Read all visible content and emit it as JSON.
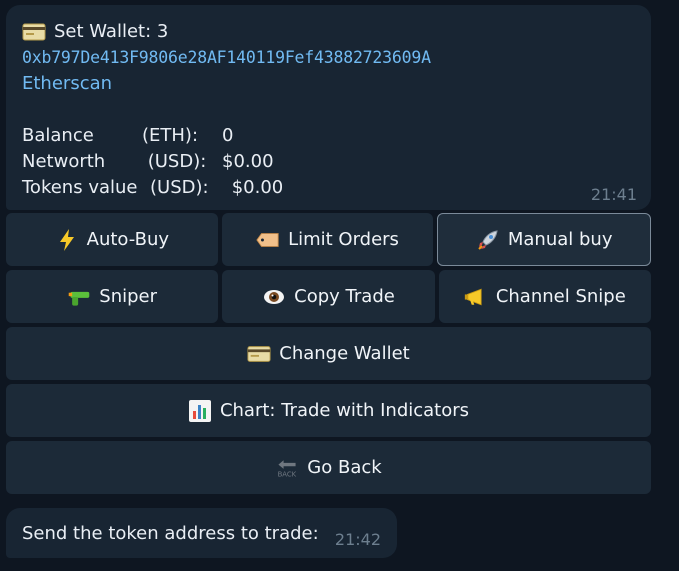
{
  "message": {
    "title": "Set Wallet: 3",
    "address": "0xb797De413F9806e28AF140119Fef43882723609A",
    "explorer_link": "Etherscan",
    "rows": [
      {
        "key": "Balance",
        "unit": "(ETH):",
        "value": "0"
      },
      {
        "key": "Networth",
        "unit": " (USD):",
        "value": "$0.00"
      },
      {
        "key": "Tokens value",
        "unit": "(USD):",
        "value": " $0.00"
      }
    ],
    "time": "21:41"
  },
  "keyboard": {
    "auto_buy": "Auto-Buy",
    "limit_orders": "Limit Orders",
    "manual_buy": "Manual buy",
    "sniper": "Sniper",
    "copy_trade": "Copy Trade",
    "channel_snipe": "Channel Snipe",
    "change_wallet": "Change Wallet",
    "chart": "Chart: Trade with Indicators",
    "go_back": "Go Back"
  },
  "icons": {
    "wallet": "credit-card-icon",
    "auto_buy": "lightning-icon",
    "limit_orders": "ticket-icon",
    "manual_buy": "rocket-icon",
    "sniper": "water-gun-icon",
    "copy_trade": "eye-icon",
    "channel_snipe": "megaphone-icon",
    "change_wallet": "credit-card-icon",
    "chart": "bar-chart-icon",
    "go_back": "back-arrow-icon"
  },
  "reply": {
    "text": "Send the token address to trade:",
    "time": "21:42"
  }
}
